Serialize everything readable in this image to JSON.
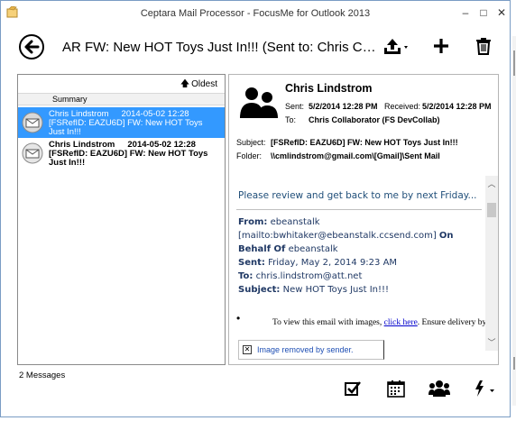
{
  "window": {
    "title": "Ceptara Mail Processor - FocusMe for Outlook 2013",
    "minimize": "–",
    "maximize": "□",
    "close": "✕"
  },
  "toolbar": {
    "subject": "AR FW: New HOT Toys Just In!!! (Sent to: Chris Collaborator (FS DevCollab)",
    "icons": [
      "back-arrow-icon",
      "upload-icon",
      "plus-icon",
      "trash-icon"
    ]
  },
  "list": {
    "sort_label": "Oldest",
    "column_header": "Summary",
    "items": [
      {
        "name": "Chris Lindstrom",
        "date": "2014-05-02 12:28",
        "subject": "[FSRefID: EAZU6D] FW: New HOT Toys Just In!!!",
        "selected": true
      },
      {
        "name": "Chris Lindstrom",
        "date": "2014-05-02 12:28",
        "subject": "[FSRefID: EAZU6D] FW: New HOT Toys Just In!!!",
        "selected": false
      }
    ]
  },
  "message": {
    "sender": "Chris Lindstrom",
    "sent_label": "Sent:",
    "sent_value": "5/2/2014 12:28 PM",
    "received_label": "Received:",
    "received_value": "5/2/2014 12:28 PM",
    "to_label": "To:",
    "to_value": "Chris Collaborator (FS DevCollab)",
    "subject_label": "Subject:",
    "subject_value": "[FSRefID: EAZU6D] FW: New HOT Toys Just In!!!",
    "folder_label": "Folder:",
    "folder_value": "\\\\cmlindstrom@gmail.com\\[Gmail]\\Sent Mail",
    "body": {
      "first_line": "Please review and get back to me by next Friday...",
      "from_label": "From:",
      "from_value": "ebeanstalk",
      "mailto": "[mailto:bwhitaker@ebeanstalk.ccsend.com]",
      "on_behalf_label": "On Behalf Of",
      "on_behalf_value": "ebeanstalk",
      "sent_label": "Sent:",
      "sent_value": "Friday, May 2, 2014 9:23 AM",
      "to_label": "To:",
      "to_value": "chris.lindstrom@att.net",
      "subject_label": "Subject:",
      "subject_value": "New HOT Toys Just In!!!",
      "bullet": "•",
      "view_text": "To view this email with images,",
      "view_link": "click here",
      "view_tail": ". Ensure delivery by ac",
      "image_removed": "Image removed by sender."
    }
  },
  "status": {
    "message_count": "2 Messages"
  },
  "bottom_toolbar": {
    "icons": [
      "checkbox-icon",
      "calendar-icon",
      "group-icon",
      "lightning-icon"
    ]
  }
}
